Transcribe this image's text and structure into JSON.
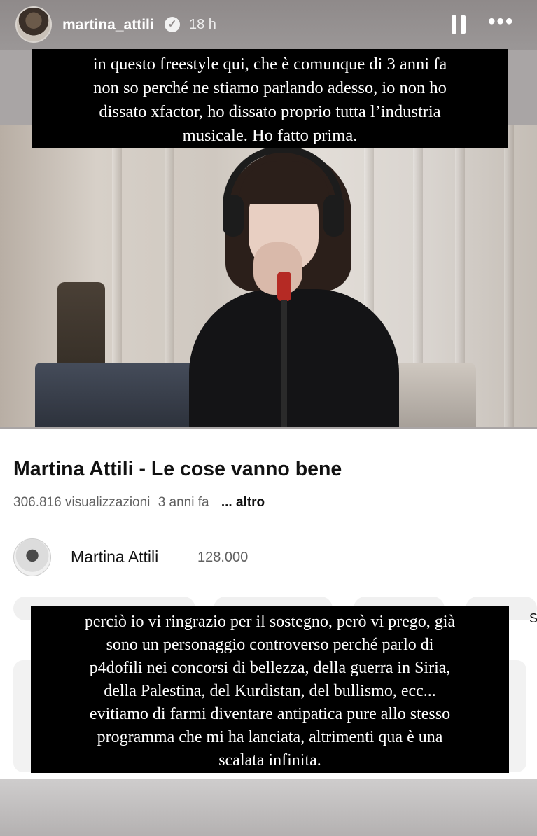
{
  "story": {
    "username": "martina_attili",
    "time": "18 h",
    "verified_icon": "verified-badge-icon",
    "pause_icon": "pause-icon",
    "more_icon": "more-options-icon",
    "more_symbol": "•••"
  },
  "caption_top": {
    "lines": [
      "in questo freestyle qui, che è comunque di 3 anni fa",
      "non so perché ne stiamo parlando adesso, io non ho",
      "dissato xfactor, ho dissato proprio tutta l’industria",
      "musicale. Ho fatto prima."
    ]
  },
  "video": {
    "title": "Martina Attili - Le cose vanno bene",
    "views": "306.816 visualizzazioni",
    "age": "3 anni fa",
    "more_label": "... altro",
    "channel_name": "Martina Attili",
    "subscribers": "128.000",
    "partial_chip": "Sca"
  },
  "caption_bottom": {
    "lines": [
      "perciò io vi ringrazio per il sostegno, però vi prego, già",
      "sono un personaggio controverso perché parlo di",
      "p4dofili nei concorsi di bellezza, della guerra in Siria,",
      "della Palestina, del Kurdistan, del bullismo, ecc...",
      "evitiamo di farmi diventare antipatica pure allo stesso",
      "programma che mi ha lanciata, altrimenti qua è una",
      "scalata infinita."
    ]
  }
}
